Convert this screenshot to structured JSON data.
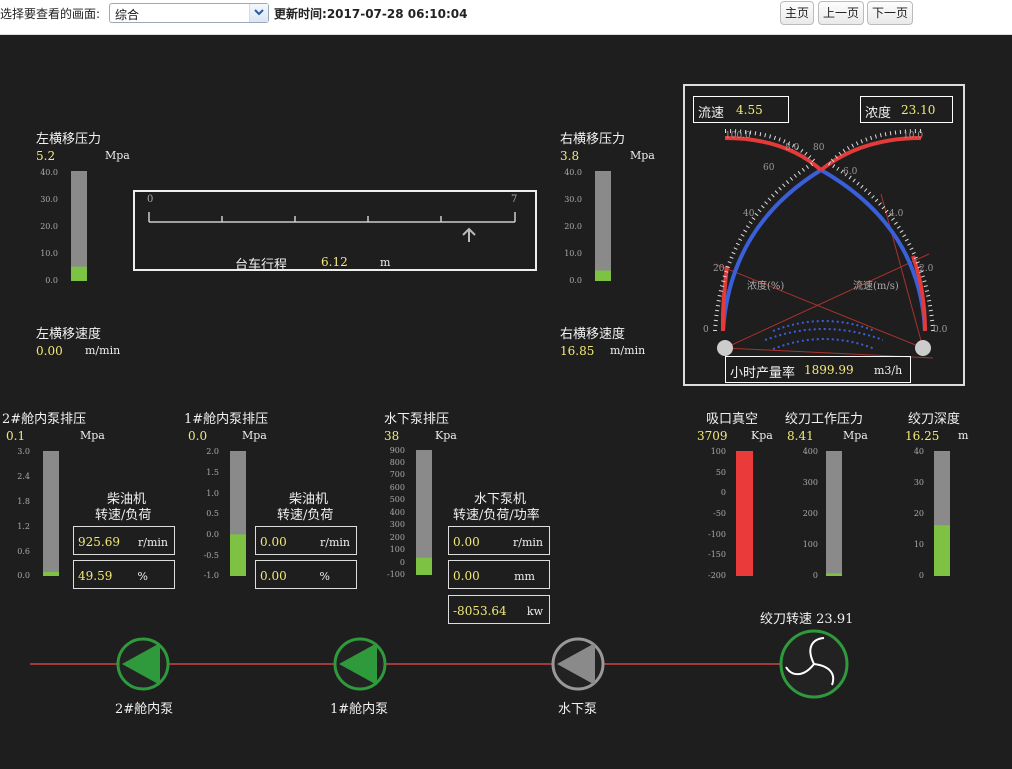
{
  "toolbar": {
    "select_label": "选择要查看的画面:",
    "select_value": "综合",
    "time_label": "更新时间:",
    "time_value": "2017-07-28 06:10:04",
    "home_button": "主页",
    "prev_button": "上一页",
    "next_button": "下一页"
  },
  "left_pressure": {
    "label": "左横移压力",
    "value": "5.2",
    "unit": "Mpa",
    "ticks": [
      "40.0",
      "30.0",
      "20.0",
      "10.0",
      "0.0"
    ],
    "level": 0.13
  },
  "right_pressure": {
    "label": "右横移压力",
    "value": "3.8",
    "unit": "Mpa",
    "ticks": [
      "40.0",
      "30.0",
      "20.0",
      "10.0",
      "0.0"
    ],
    "level": 0.095
  },
  "trolley": {
    "label": "台车行程",
    "value": "6.12",
    "unit": "m",
    "min": "0",
    "max": "7"
  },
  "left_speed": {
    "label": "左横移速度",
    "value": "0.00",
    "unit": "m/min"
  },
  "right_speed": {
    "label": "右横移速度",
    "value": "16.85",
    "unit": "m/min"
  },
  "dial": {
    "flow_label": "流速",
    "flow_value": "4.55",
    "density_label": "浓度",
    "density_value": "23.10",
    "density_axis": "浓度(%)",
    "flow_axis": "流速(m/s)",
    "hourly_label": "小时产量率",
    "hourly_value": "1899.99",
    "hourly_unit": "m3/h",
    "left_ticks": [
      "100.0",
      "80",
      "60",
      "40",
      "20",
      "0"
    ],
    "right_ticks": [
      "10.0",
      "8.0",
      "6.0",
      "4.0",
      "2.0",
      "0.0"
    ]
  },
  "pump2": {
    "label": "2#舱内泵排压",
    "value": "0.1",
    "unit": "Mpa",
    "ticks": [
      "3.0",
      "2.4",
      "1.8",
      "1.2",
      "0.6",
      "0.0"
    ],
    "level": 0.033
  },
  "pump1": {
    "label": "1#舱内泵排压",
    "value": "0.0",
    "unit": "Mpa",
    "ticks": [
      "2.0",
      "1.5",
      "1.0",
      "0.5",
      "0.0",
      "-0.5",
      "-1.0"
    ],
    "level": 0.333
  },
  "underwater": {
    "label": "水下泵排压",
    "value": "38",
    "unit": "Kpa",
    "ticks": [
      "900",
      "800",
      "700",
      "600",
      "500",
      "400",
      "300",
      "200",
      "100",
      "0",
      "-100"
    ],
    "level": 0.138
  },
  "diesel2": {
    "title1": "柴油机",
    "title2": "转速/负荷",
    "speed": "925.69",
    "speed_unit": "r/min",
    "load": "49.59",
    "load_unit": "%"
  },
  "diesel1": {
    "title1": "柴油机",
    "title2": "转速/负荷",
    "speed": "0.00",
    "speed_unit": "r/min",
    "load": "0.00",
    "load_unit": "%"
  },
  "uw_pump": {
    "title1": "水下泵机",
    "title2": "转速/负荷/功率",
    "speed": "0.00",
    "speed_unit": "r/min",
    "load": "0.00",
    "load_unit": "mm",
    "power": "-8053.64",
    "power_unit": "kw"
  },
  "suction": {
    "label": "吸口真空",
    "value": "3709",
    "unit": "Kpa",
    "ticks": [
      "100",
      "50",
      "0",
      "-50",
      "-100",
      "-150",
      "-200"
    ],
    "level": 1.0
  },
  "cutter_pressure": {
    "label": "绞刀工作压力",
    "value": "8.41",
    "unit": "Mpa",
    "ticks": [
      "400",
      "300",
      "200",
      "100",
      "0"
    ],
    "level": 0.021
  },
  "cutter_depth": {
    "label": "绞刀深度",
    "value": "16.25",
    "unit": "m",
    "ticks": [
      "40",
      "30",
      "20",
      "10",
      "0"
    ],
    "level": 0.406
  },
  "cutter_speed": {
    "label": "绞刀转速",
    "value": "23.91"
  },
  "pipeline": {
    "pump2_label": "2#舱内泵",
    "pump1_label": "1#舱内泵",
    "uw_label": "水下泵"
  },
  "colors": {
    "panel": "#1e1e1e",
    "value": "#f3e978",
    "bar_green": "#7dc242",
    "bar_red": "#ea3a3a",
    "pipe": "#a33a3a",
    "pump_active": "#2f9a3c",
    "dial_blue": "#3a5fd9",
    "dial_red": "#e33a3a"
  }
}
